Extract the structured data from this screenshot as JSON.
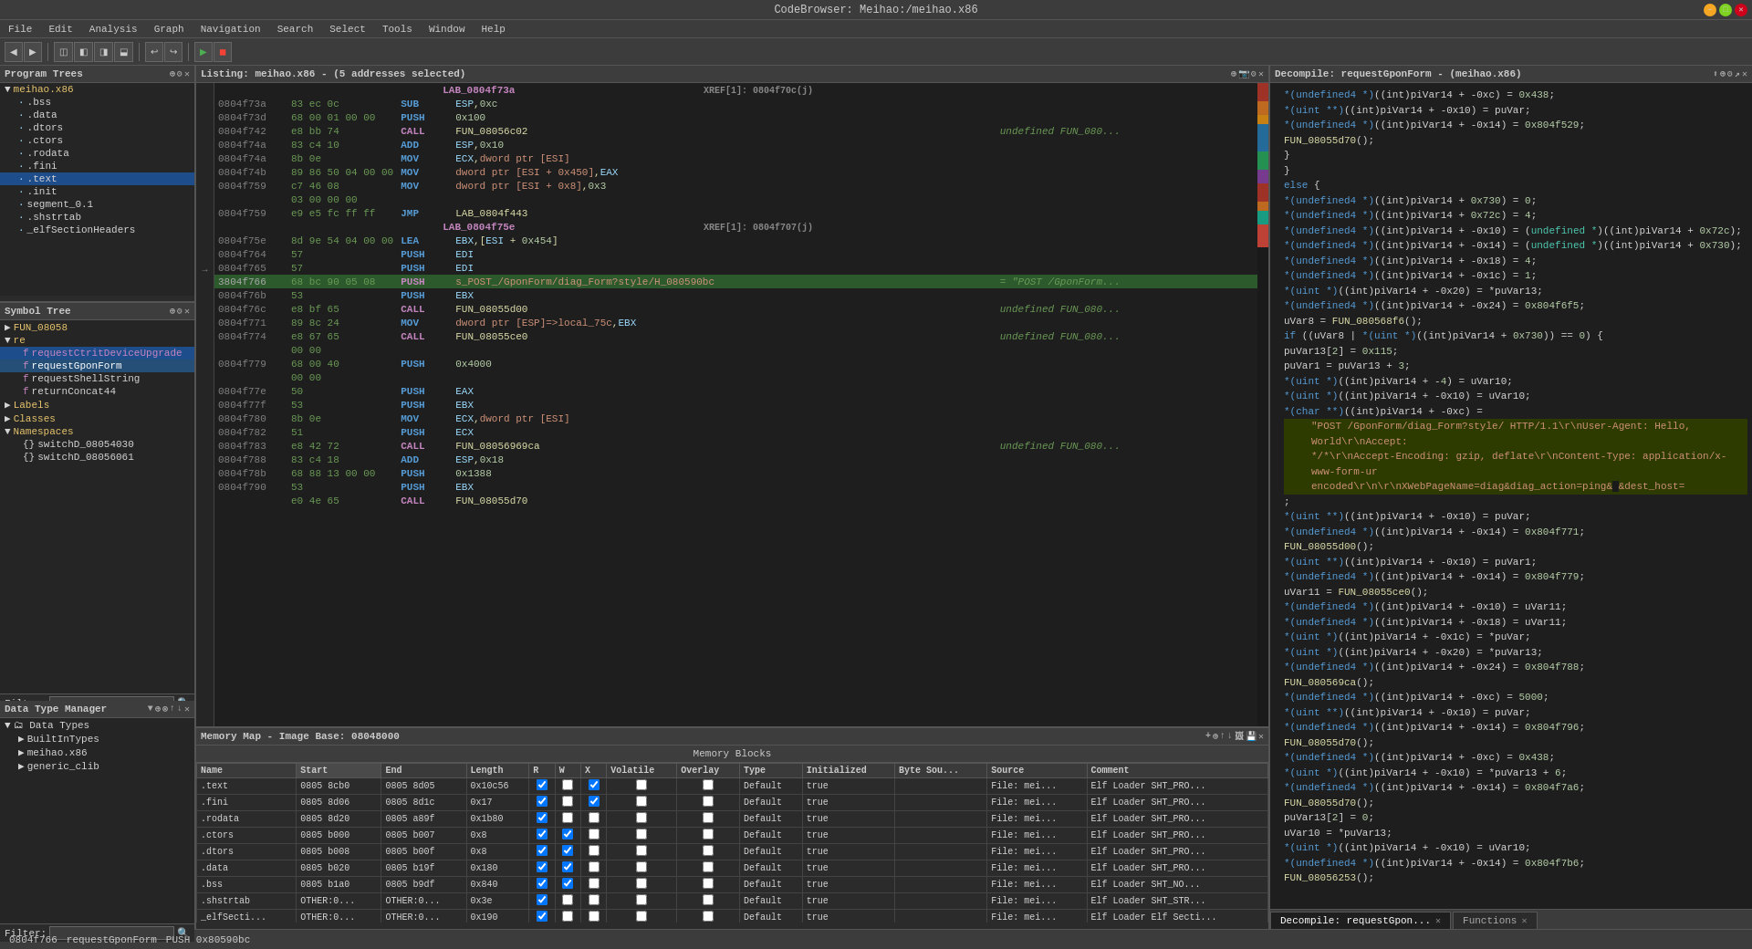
{
  "window": {
    "title": "CodeBrowser: Meihao:/meihao.x86",
    "min": "−",
    "max": "□",
    "close": "✕"
  },
  "menu": {
    "items": [
      "File",
      "Edit",
      "Analysis",
      "Graph",
      "Navigation",
      "Search",
      "Select",
      "Tools",
      "Window",
      "Help"
    ]
  },
  "program_trees": {
    "title": "Program Trees",
    "root": "meihao.x86",
    "sections": [
      ".bss",
      ".data",
      ".dtors",
      ".ctors",
      ".rodata",
      ".fini",
      ".text",
      ".init",
      "segment_0.1",
      ".shstrtab",
      "_elfSectionHeaders"
    ],
    "selected": ".text"
  },
  "symbol_tree": {
    "title": "Symbol Tree",
    "items": [
      {
        "label": "FUN_08058",
        "type": "folder"
      },
      {
        "label": "re",
        "type": "folder"
      },
      {
        "label": "requestCtritDeviceUpgrade",
        "type": "func",
        "selected": true
      },
      {
        "label": "requestGponForm",
        "type": "func",
        "active": true
      },
      {
        "label": "requestShellString",
        "type": "func"
      },
      {
        "label": "returnConcat44",
        "type": "func"
      },
      {
        "label": "Labels",
        "type": "folder"
      },
      {
        "label": "Classes",
        "type": "folder"
      },
      {
        "label": "Namespaces",
        "type": "folder"
      },
      {
        "label": "switchD_08054030",
        "type": "item"
      },
      {
        "label": "switchD_08056061",
        "type": "item"
      }
    ]
  },
  "listing": {
    "title": "Listing:  meihao.x86 - (5 addresses selected)",
    "rows": [
      {
        "addr": "",
        "bytes": "",
        "label": "LAB_0804f73a",
        "xref": "0804f70c(j)",
        "type": "label"
      },
      {
        "addr": "0804f73a",
        "bytes": "83 ec 0c",
        "mnemonic": "SUB",
        "operand": "ESP,0xc"
      },
      {
        "addr": "0804f73d",
        "bytes": "68 00 01 00 00",
        "mnemonic": "PUSH",
        "operand": "0x100"
      },
      {
        "addr": "0804f742",
        "bytes": "e8 bb 74",
        "mnemonic": "CALL",
        "operand": "FUN_08056c02",
        "comment": "undefined FUN_080..."
      },
      {
        "addr": "0804f74a",
        "bytes": "83 c4 10",
        "mnemonic": "ADD",
        "operand": "ESP,0x10"
      },
      {
        "addr": "0804f74a",
        "bytes": "8b 0e",
        "mnemonic": "MOV",
        "operand": "ECX,dword ptr [ESI]"
      },
      {
        "addr": "0804f74b",
        "bytes": "89 86 50 04 00 00",
        "mnemonic": "MOV",
        "operand": "dword ptr [ESI + 0x450],EAX"
      },
      {
        "addr": "0804f759",
        "bytes": "c7 46 08",
        "mnemonic": "MOV",
        "operand": "dword ptr [ESI + 0x8],0x3"
      },
      {
        "addr": "",
        "bytes": "03 00 00 00",
        "mnemonic": "",
        "operand": ""
      },
      {
        "addr": "0804f759",
        "bytes": "e9 e5 fc ff ff",
        "mnemonic": "JMP",
        "operand": "LAB_0804f443"
      },
      {
        "addr": "",
        "bytes": "",
        "label": "LAB_0804f75e",
        "xref": "0804f707(j)",
        "type": "label"
      },
      {
        "addr": "0804f75e",
        "bytes": "8d 9e 54 04 00 00",
        "mnemonic": "LEA",
        "operand": "EBX,[ESI + 0x454]"
      },
      {
        "addr": "0804f764",
        "bytes": "57",
        "mnemonic": "PUSH",
        "operand": "EDI"
      },
      {
        "addr": "0804f765",
        "bytes": "57",
        "mnemonic": "PUSH",
        "operand": "EDI"
      },
      {
        "addr": "0804f766",
        "bytes": "68 bc 90 05 08",
        "mnemonic": "PUSH",
        "operand": "s_POST_/GponForm/diag_Form?style/H_080590bc",
        "comment": "= \"POST /GponForm...",
        "highlight": true
      },
      {
        "addr": "0804f76b",
        "bytes": "53",
        "mnemonic": "PUSH",
        "operand": "EBX"
      },
      {
        "addr": "0804f76c",
        "bytes": "e8 bf 65",
        "mnemonic": "CALL",
        "operand": "FUN_08055d00",
        "comment": "undefined FUN_080..."
      },
      {
        "addr": "0804f771",
        "bytes": "89 8c 24",
        "mnemonic": "MOV",
        "operand": "dword ptr [ESP]=>local_75c,EBX"
      },
      {
        "addr": "0804f774",
        "bytes": "e8 67 65",
        "mnemonic": "CALL",
        "operand": "FUN_08055ce0",
        "comment": "undefined FUN_080..."
      },
      {
        "addr": "",
        "bytes": "00 00",
        "mnemonic": "",
        "operand": ""
      },
      {
        "addr": "0804f779",
        "bytes": "68 00 40",
        "mnemonic": "PUSH",
        "operand": "0x4000"
      },
      {
        "addr": "",
        "bytes": "00 00",
        "mnemonic": "",
        "operand": ""
      },
      {
        "addr": "0804f77e",
        "bytes": "50",
        "mnemonic": "PUSH",
        "operand": "EAX"
      },
      {
        "addr": "0804f77f",
        "bytes": "53",
        "mnemonic": "PUSH",
        "operand": "EBX"
      },
      {
        "addr": "0804f780",
        "bytes": "8b 0e",
        "mnemonic": "MOV",
        "operand": "ECX,dword ptr [ESI]"
      },
      {
        "addr": "0804f782",
        "bytes": "51",
        "mnemonic": "PUSH",
        "operand": "ECX"
      },
      {
        "addr": "0804f783",
        "bytes": "e8 42 72",
        "mnemonic": "CALL",
        "operand": "FUN_08056969ca",
        "comment": "undefined FUN_080..."
      },
      {
        "addr": "",
        "bytes": "",
        "mnemonic": "",
        "operand": ""
      },
      {
        "addr": "0804f788",
        "bytes": "83 c4 18",
        "mnemonic": "ADD",
        "operand": "ESP,0x18"
      },
      {
        "addr": "0804f78b",
        "bytes": "68 88 13 00 00",
        "mnemonic": "PUSH",
        "operand": "0x1388"
      },
      {
        "addr": "0804f790",
        "bytes": "53",
        "mnemonic": "PUSH",
        "operand": "EBX"
      },
      {
        "addr": "",
        "bytes": "e0 4e 65",
        "mnemonic": "CALL",
        "operand": "FUN_08055d70"
      }
    ]
  },
  "memory_map": {
    "title": "Memory Map - Image Base: 08048000",
    "subtitle": "Memory Blocks",
    "toolbar_icons": [
      "+",
      "✕",
      "↑",
      "↓",
      "⊕",
      "⊗"
    ],
    "columns": [
      "Name",
      "Start",
      "End",
      "Length",
      "R",
      "W",
      "X",
      "Volatile",
      "Overlay",
      "Type",
      "Initialized",
      "Byte Sou...",
      "Source",
      "Comment"
    ],
    "rows": [
      {
        ".text": ".text",
        "start": "0805 8cb0",
        "end": "0805 8d05",
        "length": "0x10c56",
        "r": true,
        "w": false,
        "x": true,
        "volatile": false,
        "overlay": false,
        "type": "Default",
        "init": true,
        "bytesrc": "",
        "source": "File: mei...",
        "comment": "Elf Loader   SHT_PRO..."
      },
      {
        ".text": ".fini",
        "start": "0805 8d06",
        "end": "0805 8d1c",
        "length": "0x17",
        "r": true,
        "w": false,
        "x": true,
        "volatile": false,
        "overlay": false,
        "type": "Default",
        "init": true,
        "bytesrc": "",
        "source": "File: mei...",
        "comment": "Elf Loader   SHT_PRO..."
      },
      {
        ".text": ".rodata",
        "start": "0805 8d20",
        "end": "0805 a89f",
        "length": "0x1b80",
        "r": true,
        "w": false,
        "x": false,
        "volatile": false,
        "overlay": false,
        "type": "Default",
        "init": true,
        "bytesrc": "",
        "source": "File: mei...",
        "comment": "Elf Loader   SHT_PRO..."
      },
      {
        ".text": ".ctors",
        "start": "0805 b000",
        "end": "0805 b007",
        "length": "0x8",
        "r": true,
        "w": true,
        "x": false,
        "volatile": false,
        "overlay": false,
        "type": "Default",
        "init": true,
        "bytesrc": "",
        "source": "File: mei...",
        "comment": "Elf Loader   SHT_PRO..."
      },
      {
        ".text": ".dtors",
        "start": "0805 b008",
        "end": "0805 b00f",
        "length": "0x8",
        "r": true,
        "w": true,
        "x": false,
        "volatile": false,
        "overlay": false,
        "type": "Default",
        "init": true,
        "bytesrc": "",
        "source": "File: mei...",
        "comment": "Elf Loader   SHT_PRO..."
      },
      {
        ".text": ".data",
        "start": "0805 b020",
        "end": "0805 b19f",
        "length": "0x180",
        "r": true,
        "w": true,
        "x": false,
        "volatile": false,
        "overlay": false,
        "type": "Default",
        "init": true,
        "bytesrc": "",
        "source": "File: mei...",
        "comment": "Elf Loader   SHT_PRO..."
      },
      {
        ".text": ".bss",
        "start": "0805 b1a0",
        "end": "0805 b9df",
        "length": "0x840",
        "r": true,
        "w": true,
        "x": false,
        "volatile": false,
        "overlay": false,
        "type": "Default",
        "init": true,
        "bytesrc": "",
        "source": "File: mei...",
        "comment": "Elf Loader   SHT_NO..."
      },
      {
        ".text": ".shstrtab",
        "start": "OTHER:0...",
        "end": "OTHER:0...",
        "length": "0x3e",
        "r": true,
        "w": false,
        "x": false,
        "volatile": false,
        "overlay": false,
        "type": "Default",
        "init": true,
        "bytesrc": "",
        "source": "File: mei...",
        "comment": "Elf Loader   SHT_STR..."
      },
      {
        ".text": "_elfSecti...",
        "start": "OTHER:0...",
        "end": "OTHER:0...",
        "length": "0x190",
        "r": true,
        "w": false,
        "x": false,
        "volatile": false,
        "overlay": false,
        "type": "Default",
        "init": true,
        "bytesrc": "",
        "source": "File: mei...",
        "comment": "Elf Loader   Elf Secti..."
      }
    ],
    "filter": ""
  },
  "decompile": {
    "title": "Decompile: requestGponForm - (meihao.x86)",
    "code_lines": [
      "    *(undefined4 *)((int)piVar14 + -0xc) = 0x438;",
      "    *(uint **)((int)piVar14 + -0x10) = puVar;",
      "    *(undefined4 *)((int)piVar14 + -0x14) = 0x804f529;",
      "    FUN_08055d70();",
      "  }",
      "}",
      "else {",
      "  *(undefined4 *)((int)piVar14 + 0x730) = 0;",
      "  *(undefined4 *)((int)piVar14 + 0x72c) = 4;",
      "  *(undefined4 *)((int)piVar14 + -0x10) = (undefined *)((int)piVar14 + 0x72c);",
      "  *(undefined4 *)((int)piVar14 + -0x14) = (undefined *)((int)piVar14 + 0x730);",
      "  *(undefined4 *)((int)piVar14 + -0x18) = 4;",
      "  *(undefined4 *)((int)piVar14 + -0x1c) = 1;",
      "  *(uint *)((int)piVar14 + -0x20) = *puVar13;",
      "  *(undefined4 *)((int)piVar14 + -0x24) = 0x804f6f5;",
      "  uVar8 = FUN_080568f6();",
      "  if ((uVar8 | *(uint *)((int)piVar14 + 0x730)) == 0) {",
      "    puVar13[2] = 0x115;",
      "    puVar1 = puVar13 + 3;",
      "    *(uint *)((int)piVar14 + -4) = uVar10;",
      "    *(uint *)((int)piVar14 + -0x10) = uVar10;",
      "    *(char **)((int)piVar14 + -0xc) =",
      "      \"POST /GponForm/diag_Form?style/ HTTP/1.1\\r\\nUser-Agent: Hello, World\\r\\nAccept:",
      "      */*\\r\\nAccept-Encoding: gzip, deflate\\r\\nContent-Type: application/x-www-form-ur",
      "      encoded\\r\\n\\r\\nXWebPageName=diag&diag_action=ping&                  &dest_host=",
      "    ;",
      "    *(uint **)((int)piVar14 + -0x10) = puVar;",
      "    *(undefined4 *)((int)piVar14 + -0x14) = 0x804f771;",
      "    FUN_08055d00();",
      "    *(uint **)((int)piVar14 + -0x10) = puVar1;",
      "    *(undefined4 *)((int)piVar14 + -0x14) = 0x804f779;",
      "    uVar11 = FUN_08055ce0();",
      "    *(undefined4 *)((int)piVar14 + -0x10) = uVar11;",
      "    *(undefined4 *)((int)piVar14 + -0x18) = uVar11;",
      "    *(uint *)((int)piVar14 + -0x1c) = *puVar;",
      "    *(uint *)((int)piVar14 + -0x20) = *puVar13;",
      "    *(undefined4 *)((int)piVar14 + -0x24) = 0x804f788;",
      "    FUN_080569ca();",
      "    *(undefined4 *)((int)piVar14 + -0xc) = 5000;",
      "    *(uint **)((int)piVar14 + -0x10) = puVar;",
      "    *(undefined4 *)((int)piVar14 + -0x14) = 0x804f796;",
      "    FUN_08055d70();",
      "    *(undefined4 *)((int)piVar14 + -0xc) = 0x438;",
      "    *(uint *)((int)piVar14 + -0x10) = *puVar13 + 6;",
      "    *(undefined4 *)((int)piVar14 + -0x14) = 0x804f7a6;",
      "    FUN_08055d70();",
      "    puVar13[2] = 0;",
      "    uVar10 = *puVar13;",
      "    *(uint *)((int)piVar14 + -0x10) = uVar10;",
      "    *(undefined4 *)((int)piVar14 + -0x14) = 0x804f7b6;",
      "    FUN_08056253();"
    ]
  },
  "bottom_tabs": [
    {
      "label": "Decompile: requestGpon...",
      "active": true,
      "closeable": true
    },
    {
      "label": "Functions",
      "active": false,
      "closeable": true
    }
  ],
  "status_bar": {
    "addr": "0804f766",
    "func": "requestGponForm",
    "instruction": "PUSH 0x80590bc"
  },
  "data_type_manager": {
    "title": "Data Type Manager",
    "types": [
      {
        "label": "Data Types",
        "type": "folder"
      },
      {
        "label": "BuiltInTypes",
        "type": "folder"
      },
      {
        "label": "meihao.x86",
        "type": "folder"
      },
      {
        "label": "generic_clib",
        "type": "folder"
      }
    ]
  }
}
